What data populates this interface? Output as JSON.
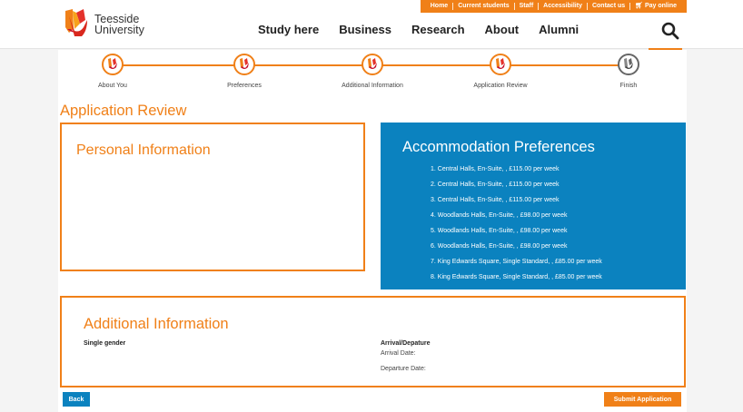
{
  "utility": {
    "links": [
      "Home",
      "Current students",
      "Staff",
      "Accessibility",
      "Contact us",
      "Pay online"
    ]
  },
  "header": {
    "logo_line1": "Teesside",
    "logo_line2": "University",
    "nav": [
      "Study here",
      "Business",
      "Research",
      "About",
      "Alumni"
    ]
  },
  "steps": [
    {
      "label": "About You",
      "state": "complete"
    },
    {
      "label": "Preferences",
      "state": "complete"
    },
    {
      "label": "Additional Information",
      "state": "complete"
    },
    {
      "label": "Application Review",
      "state": "current"
    },
    {
      "label": "Finish",
      "state": "pending"
    }
  ],
  "page_title": "Application Review",
  "personal": {
    "title": "Personal Information"
  },
  "accommodation": {
    "title": "Accommodation Preferences",
    "items": [
      "1.  Central Halls, En-Suite, , £115.00 per week",
      "2.  Central Halls, En-Suite, , £115.00 per week",
      "3.  Central Halls, En-Suite, , £115.00 per week",
      "4.  Woodlands Halls, En-Suite, , £98.00 per week",
      "5.  Woodlands Halls, En-Suite, , £98.00 per week",
      "6.  Woodlands Halls, En-Suite, , £98.00 per week",
      "7.  King Edwards Square, Single Standard, , £85.00 per week",
      "8.  King Edwards Square, Single Standard, , £85.00 per week"
    ]
  },
  "additional": {
    "title": "Additional Information",
    "single_gender_label": "Single gender",
    "arrival_heading": "Arrival/Depature",
    "arrival_date_label": "Arrival Date:",
    "departure_date_label": "Departure Date:"
  },
  "buttons": {
    "back": "Back",
    "submit": "Submit Application"
  },
  "colors": {
    "accent_orange": "#f08018",
    "accent_blue": "#0b82bf"
  }
}
